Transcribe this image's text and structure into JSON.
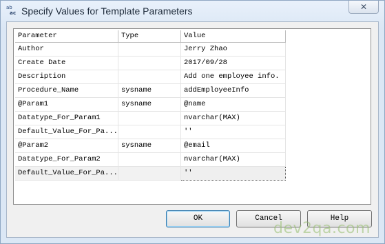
{
  "window": {
    "title": "Specify Values for Template Parameters",
    "icon_text": [
      "ab",
      "a",
      "c"
    ],
    "close_glyph": "✕"
  },
  "grid": {
    "columns": [
      "Parameter",
      "Type",
      "Value"
    ],
    "rows": [
      {
        "parameter": "Author",
        "type": "",
        "value": "Jerry Zhao"
      },
      {
        "parameter": "Create Date",
        "type": "",
        "value": "2017/09/28"
      },
      {
        "parameter": "Description",
        "type": "",
        "value": "Add one employee info."
      },
      {
        "parameter": "Procedure_Name",
        "type": "sysname",
        "value": "addEmployeeInfo"
      },
      {
        "parameter": "@Param1",
        "type": "sysname",
        "value": "@name"
      },
      {
        "parameter": "Datatype_For_Param1",
        "type": "",
        "value": "nvarchar(MAX)"
      },
      {
        "parameter": "Default_Value_For_Pa...",
        "type": "",
        "value": "''"
      },
      {
        "parameter": "@Param2",
        "type": "sysname",
        "value": "@email"
      },
      {
        "parameter": "Datatype_For_Param2",
        "type": "",
        "value": "nvarchar(MAX)"
      },
      {
        "parameter": "Default_Value_For_Pa...",
        "type": "",
        "value": "''"
      }
    ]
  },
  "buttons": {
    "ok": "OK",
    "cancel": "Cancel",
    "help": "Help"
  },
  "watermark": "dev2qa.com"
}
